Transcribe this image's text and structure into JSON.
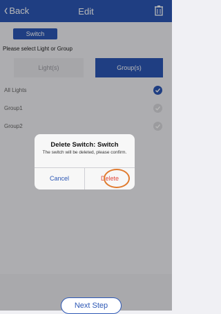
{
  "nav": {
    "back_label": "Back",
    "title": "Edit",
    "icons": {
      "back": "chevron-left-icon",
      "trash": "trash-icon"
    }
  },
  "switch_tag": "Switch",
  "prompt": "Please select Light or Group",
  "segments": {
    "lights": "Light(s)",
    "groups": "Group(s)",
    "selected": "Group(s)"
  },
  "list": [
    {
      "label": "All Lights",
      "checked": true
    },
    {
      "label": "Group1",
      "checked": false
    },
    {
      "label": "Group2",
      "checked": false
    }
  ],
  "dialog": {
    "title": "Delete Switch: Switch",
    "message": "The switch will be deleted, please confirm.",
    "cancel": "Cancel",
    "delete": "Delete"
  },
  "footer": {
    "next_step": "Next Step"
  },
  "colors": {
    "primary": "#2c57b5",
    "delete": "#e14a3b",
    "highlight": "#e07a2d"
  }
}
